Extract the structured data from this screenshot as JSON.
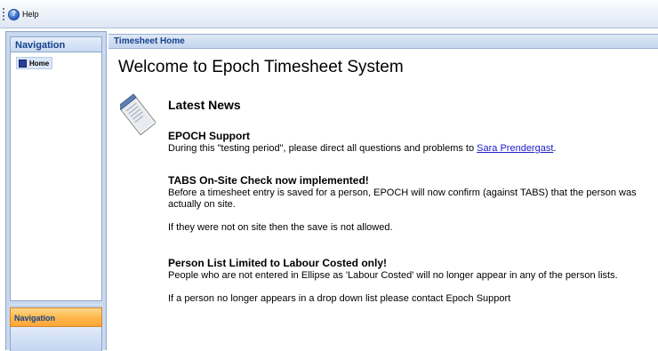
{
  "toolbar": {
    "help_label": "Help"
  },
  "navigation": {
    "header": "Navigation",
    "items": [
      {
        "label": "Home"
      }
    ],
    "bottom_bar": "Navigation"
  },
  "main": {
    "panel_title": "Timesheet Home",
    "welcome": "Welcome to Epoch Timesheet System",
    "latest_news": "Latest News",
    "news": [
      {
        "title": "EPOCH Support",
        "text_before_link": "During this \"testing period\", please direct all questions and problems to ",
        "link": "Sara Prendergast",
        "text_after_link": "."
      },
      {
        "title": "TABS On-Site Check now implemented!",
        "paragraph1": "Before a timesheet entry is saved for a person, EPOCH will now confirm (against TABS) that the person was actually on site.",
        "paragraph2": "If they were not on site then the save is not allowed."
      },
      {
        "title": "Person List Limited to Labour Costed only!",
        "paragraph1": "People who are not entered in Ellipse as 'Labour Costed' will no longer appear in any of the person lists.",
        "paragraph2": "If a person no longer appears in a drop down list please contact Epoch Support"
      }
    ]
  },
  "icons": {
    "help": "help-icon",
    "home": "home-icon",
    "news": "news-document-icon"
  }
}
